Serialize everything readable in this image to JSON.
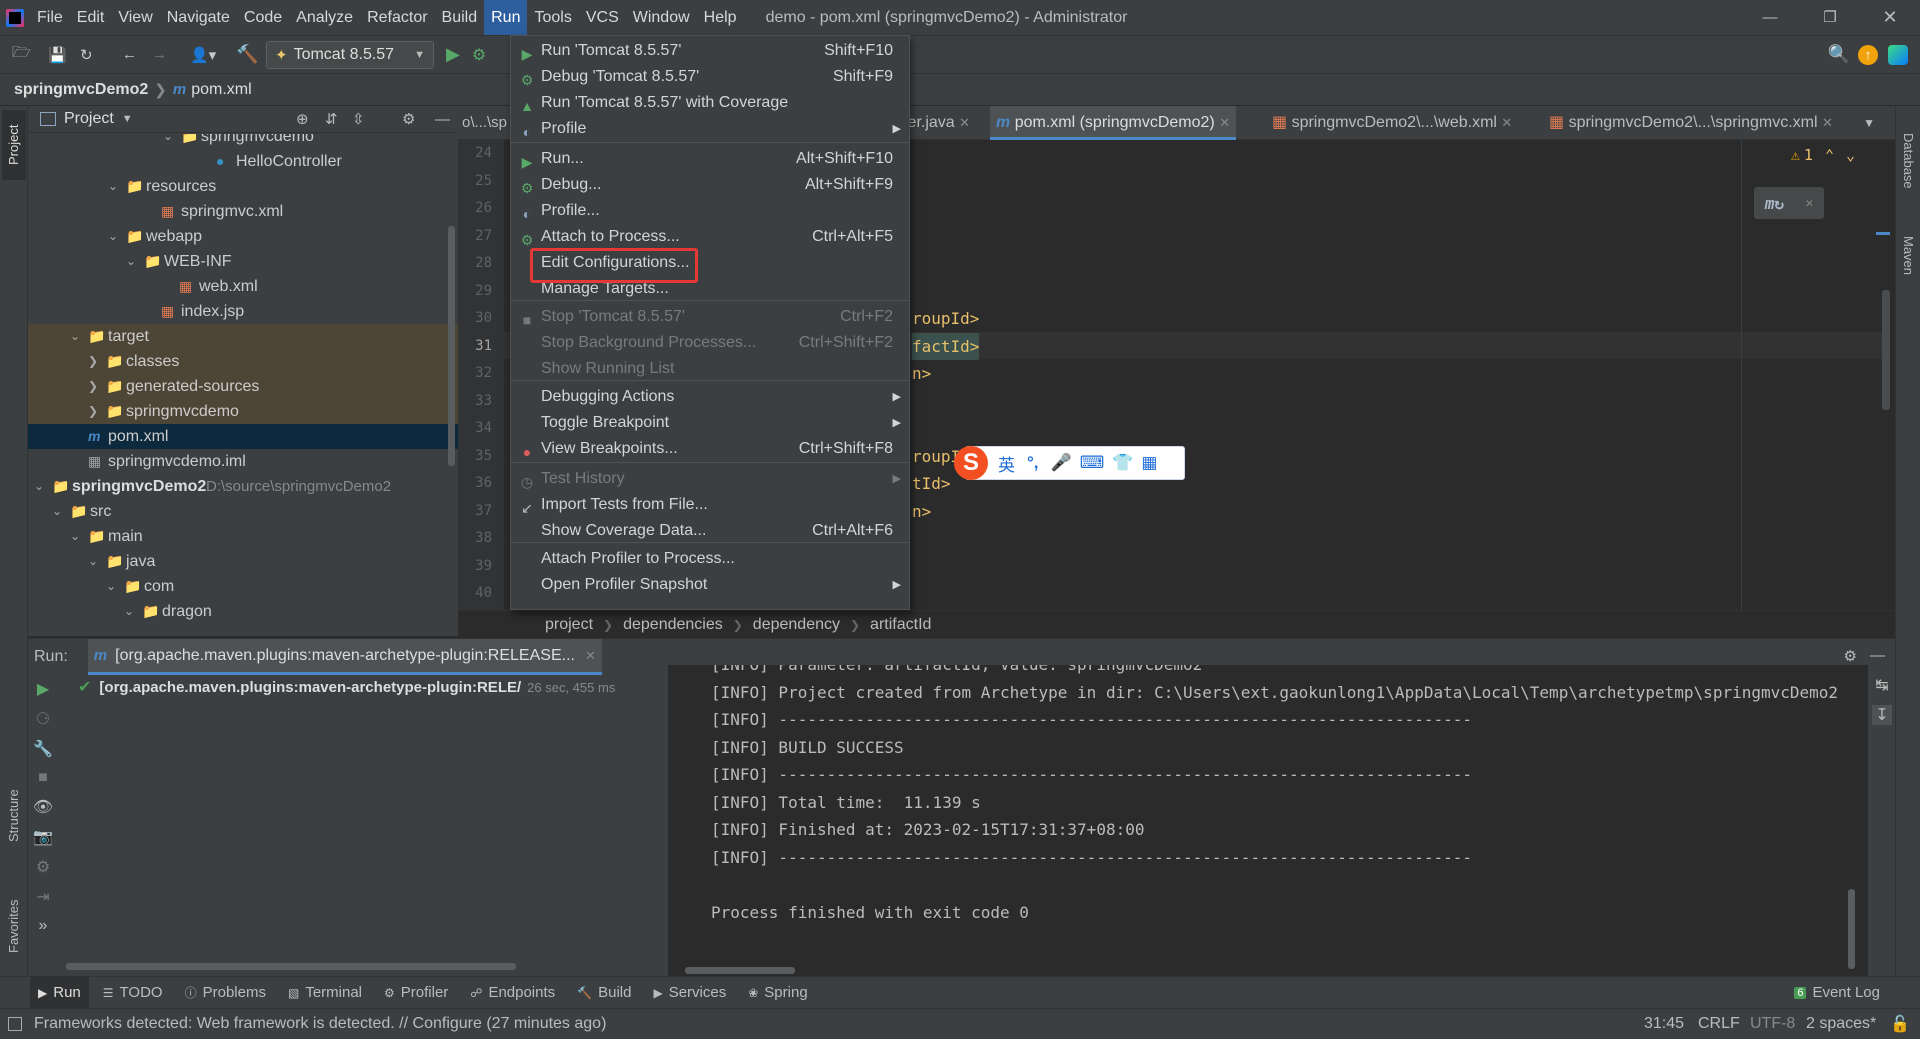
{
  "window": {
    "title": "demo - pom.xml (springmvcDemo2) - Administrator",
    "menu": [
      "File",
      "Edit",
      "View",
      "Navigate",
      "Code",
      "Analyze",
      "Refactor",
      "Build",
      "Run",
      "Tools",
      "VCS",
      "Window",
      "Help"
    ],
    "active_menu": "Run"
  },
  "toolbar": {
    "run_config": "Tomcat 8.5.57"
  },
  "nav": {
    "project": "springmvcDemo2",
    "file": "pom.xml"
  },
  "project_panel": {
    "title": "Project",
    "rows": [
      {
        "label": "springmvcdemo"
      },
      {
        "label": "HelloController"
      },
      {
        "label": "resources"
      },
      {
        "label": "springmvc.xml"
      },
      {
        "label": "webapp"
      },
      {
        "label": "WEB-INF"
      },
      {
        "label": "web.xml"
      },
      {
        "label": "index.jsp"
      },
      {
        "label": "target"
      },
      {
        "label": "classes"
      },
      {
        "label": "generated-sources"
      },
      {
        "label": "springmvcdemo"
      },
      {
        "label": "pom.xml"
      },
      {
        "label": "springmvcdemo.iml"
      },
      {
        "label": "springmvcDemo2",
        "path": "D:\\source\\springmvcDemo2"
      },
      {
        "label": "src"
      },
      {
        "label": "main"
      },
      {
        "label": "java"
      },
      {
        "label": "com"
      },
      {
        "label": "dragon"
      }
    ]
  },
  "editor": {
    "tabs": [
      {
        "label": "ler.java"
      },
      {
        "label": "pom.xml (springmvcDemo2)"
      },
      {
        "label": "springmvcDemo2\\...\\web.xml"
      },
      {
        "label": "springmvcDemo2\\...\\springmvc.xml"
      }
    ],
    "path_prefix": "o\\...\\sp",
    "warnings": "1",
    "line_numbers": [
      "24",
      "25",
      "26",
      "27",
      "28",
      "29",
      "30",
      "31",
      "32",
      "33",
      "34",
      "35",
      "36",
      "37",
      "38",
      "39",
      "40"
    ],
    "code_fragments": [
      {
        "line": "30",
        "text": "roupId>"
      },
      {
        "line": "31",
        "text": "factId>"
      },
      {
        "line": "32",
        "text": "n>"
      },
      {
        "line": "35",
        "text": "roupId"
      },
      {
        "line": "36",
        "text": "tId>"
      },
      {
        "line": "37",
        "text": "n>"
      }
    ],
    "breadcrumb": [
      "project",
      "dependencies",
      "dependency",
      "artifactId"
    ]
  },
  "run_menu": {
    "items": [
      {
        "label": "Run 'Tomcat 8.5.57'",
        "shortcut": "Shift+F10",
        "icon": "play-icon"
      },
      {
        "label": "Debug 'Tomcat 8.5.57'",
        "shortcut": "Shift+F9",
        "icon": "bug-icon"
      },
      {
        "label": "Run 'Tomcat 8.5.57' with Coverage",
        "shortcut": "",
        "icon": "coverage-icon"
      },
      {
        "label": "Profile",
        "shortcut": "",
        "icon": "profile-icon",
        "submenu": true
      },
      {
        "label": "Run...",
        "shortcut": "Alt+Shift+F10",
        "icon": "play-icon"
      },
      {
        "label": "Debug...",
        "shortcut": "Alt+Shift+F9",
        "icon": "bug-icon"
      },
      {
        "label": "Profile...",
        "shortcut": "",
        "icon": "profile-icon"
      },
      {
        "label": "Attach to Process...",
        "shortcut": "Ctrl+Alt+F5",
        "icon": "attach-icon"
      },
      {
        "label": "Edit Configurations...",
        "shortcut": "",
        "icon": ""
      },
      {
        "label": "Manage Targets...",
        "shortcut": "",
        "icon": ""
      },
      {
        "label": "Stop 'Tomcat 8.5.57'",
        "shortcut": "Ctrl+F2",
        "icon": "stop-icon",
        "disabled": true
      },
      {
        "label": "Stop Background Processes...",
        "shortcut": "Ctrl+Shift+F2",
        "disabled": true
      },
      {
        "label": "Show Running List",
        "shortcut": "",
        "disabled": true
      },
      {
        "label": "Debugging Actions",
        "shortcut": "",
        "submenu": true
      },
      {
        "label": "Toggle Breakpoint",
        "shortcut": "",
        "submenu": true
      },
      {
        "label": "View Breakpoints...",
        "shortcut": "Ctrl+Shift+F8",
        "icon": "breakpoint-icon"
      },
      {
        "label": "Test History",
        "shortcut": "",
        "icon": "history-icon",
        "submenu": true,
        "disabled": true
      },
      {
        "label": "Import Tests from File...",
        "shortcut": "",
        "icon": "import-icon"
      },
      {
        "label": "Show Coverage Data...",
        "shortcut": "Ctrl+Alt+F6"
      },
      {
        "label": "Attach Profiler to Process...",
        "shortcut": ""
      },
      {
        "label": "Open Profiler Snapshot",
        "shortcut": "",
        "submenu": true
      }
    ]
  },
  "run_panel": {
    "label": "Run:",
    "tab": "[org.apache.maven.plugins:maven-archetype-plugin:RELEASE...",
    "tree_item": "[org.apache.maven.plugins:maven-archetype-plugin:RELE/",
    "tree_time": "26 sec, 455 ms",
    "console": [
      "[INFO] Parameter: artifactId, Value: springmvcDemo2",
      "[INFO] Project created from Archetype in dir: C:\\Users\\ext.gaokunlong1\\AppData\\Local\\Temp\\archetypetmp\\springmvcDemo2",
      "[INFO] ------------------------------------------------------------------------",
      "[INFO] BUILD SUCCESS",
      "[INFO] ------------------------------------------------------------------------",
      "[INFO] Total time:  11.139 s",
      "[INFO] Finished at: 2023-02-15T17:31:37+08:00",
      "[INFO] ------------------------------------------------------------------------",
      "",
      "Process finished with exit code 0"
    ]
  },
  "bottom_tabs": [
    "Run",
    "TODO",
    "Problems",
    "Terminal",
    "Profiler",
    "Endpoints",
    "Build",
    "Services",
    "Spring"
  ],
  "event_log": {
    "count": "6",
    "label": "Event Log"
  },
  "status": {
    "message": "Frameworks detected: Web framework is detected. // Configure (27 minutes ago)",
    "position": "31:45",
    "line_sep": "CRLF",
    "encoding": "UTF-8",
    "indent": "2 spaces*"
  },
  "side_labels": {
    "left": [
      "Project",
      "Structure",
      "Favorites"
    ],
    "right": [
      "Database",
      "Maven"
    ]
  },
  "ime": {
    "lang": "英",
    "punct": "°,"
  },
  "colors": {
    "accent": "#2d5f9f",
    "highlight": "#e53935",
    "success": "#499c54"
  }
}
